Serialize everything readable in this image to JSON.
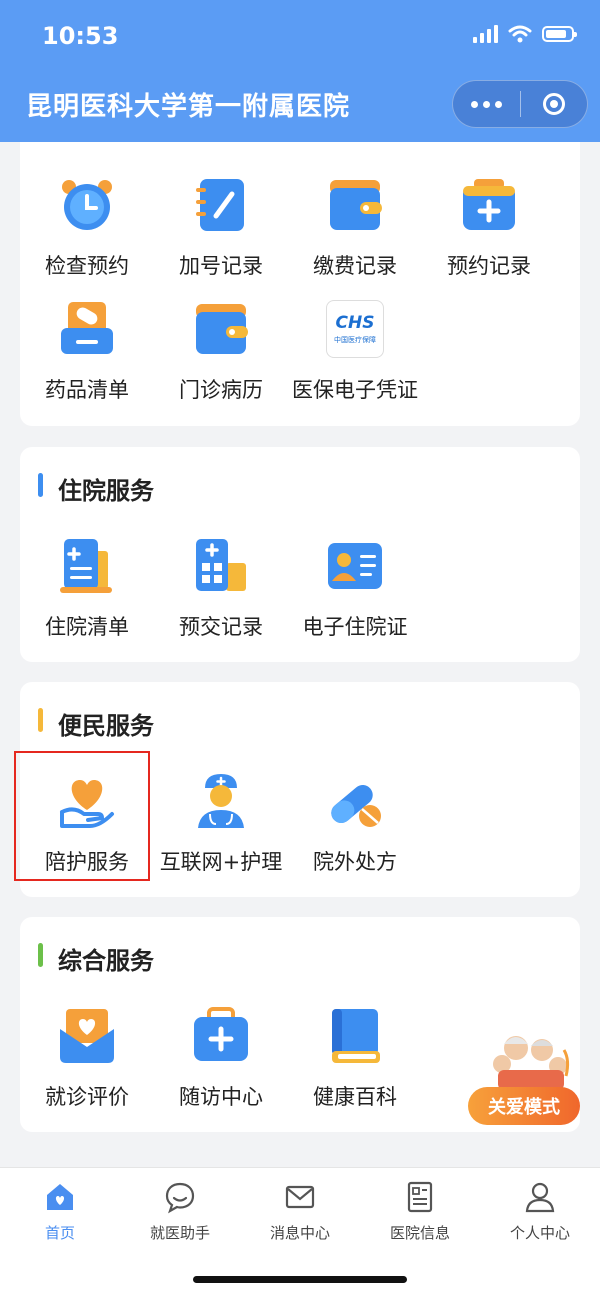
{
  "status": {
    "time": "10:53"
  },
  "header": {
    "title": "昆明医科大学第一附属医院"
  },
  "top_section": {
    "items": [
      {
        "label": "检查预约",
        "icon": "alarm-clock-icon"
      },
      {
        "label": "加号记录",
        "icon": "notebook-icon"
      },
      {
        "label": "缴费记录",
        "icon": "wallet-icon"
      },
      {
        "label": "预约记录",
        "icon": "medical-kit-icon"
      },
      {
        "label": "药品清单",
        "icon": "pill-box-icon"
      },
      {
        "label": "门诊病历",
        "icon": "record-folder-icon"
      },
      {
        "label": "医保电子凭证",
        "icon": "chs-logo-icon"
      }
    ],
    "chs_logo_text": "CHS",
    "chs_logo_sub": "中国医疗保障"
  },
  "inpatient": {
    "title": "住院服务",
    "items": [
      {
        "label": "住院清单",
        "icon": "bill-icon"
      },
      {
        "label": "预交记录",
        "icon": "hospital-building-icon"
      },
      {
        "label": "电子住院证",
        "icon": "id-card-icon"
      }
    ]
  },
  "convenience": {
    "title": "便民服务",
    "items": [
      {
        "label": "陪护服务",
        "icon": "heart-hand-icon"
      },
      {
        "label": "互联网+护理",
        "icon": "doctor-icon"
      },
      {
        "label": "院外处方",
        "icon": "capsule-icon"
      }
    ]
  },
  "general": {
    "title": "综合服务",
    "items": [
      {
        "label": "就诊评价",
        "icon": "heart-envelope-icon"
      },
      {
        "label": "随访中心",
        "icon": "first-aid-kit-icon"
      },
      {
        "label": "健康百科",
        "icon": "book-icon"
      }
    ]
  },
  "care_mode": {
    "label": "关爱模式"
  },
  "tabbar": {
    "tabs": [
      {
        "label": "首页",
        "icon": "home-icon",
        "active": true
      },
      {
        "label": "就医助手",
        "icon": "chat-bubble-icon"
      },
      {
        "label": "消息中心",
        "icon": "envelope-icon"
      },
      {
        "label": "医院信息",
        "icon": "document-icon"
      },
      {
        "label": "个人中心",
        "icon": "user-icon"
      }
    ]
  },
  "colors": {
    "header_blue": "#5b9cf4",
    "accent_blue": "#4a8ef0",
    "orange": "#f5a03a",
    "bar_blue": "#3d8ef0",
    "bar_yellow": "#f5b83a",
    "bar_green": "#6cc04a"
  }
}
